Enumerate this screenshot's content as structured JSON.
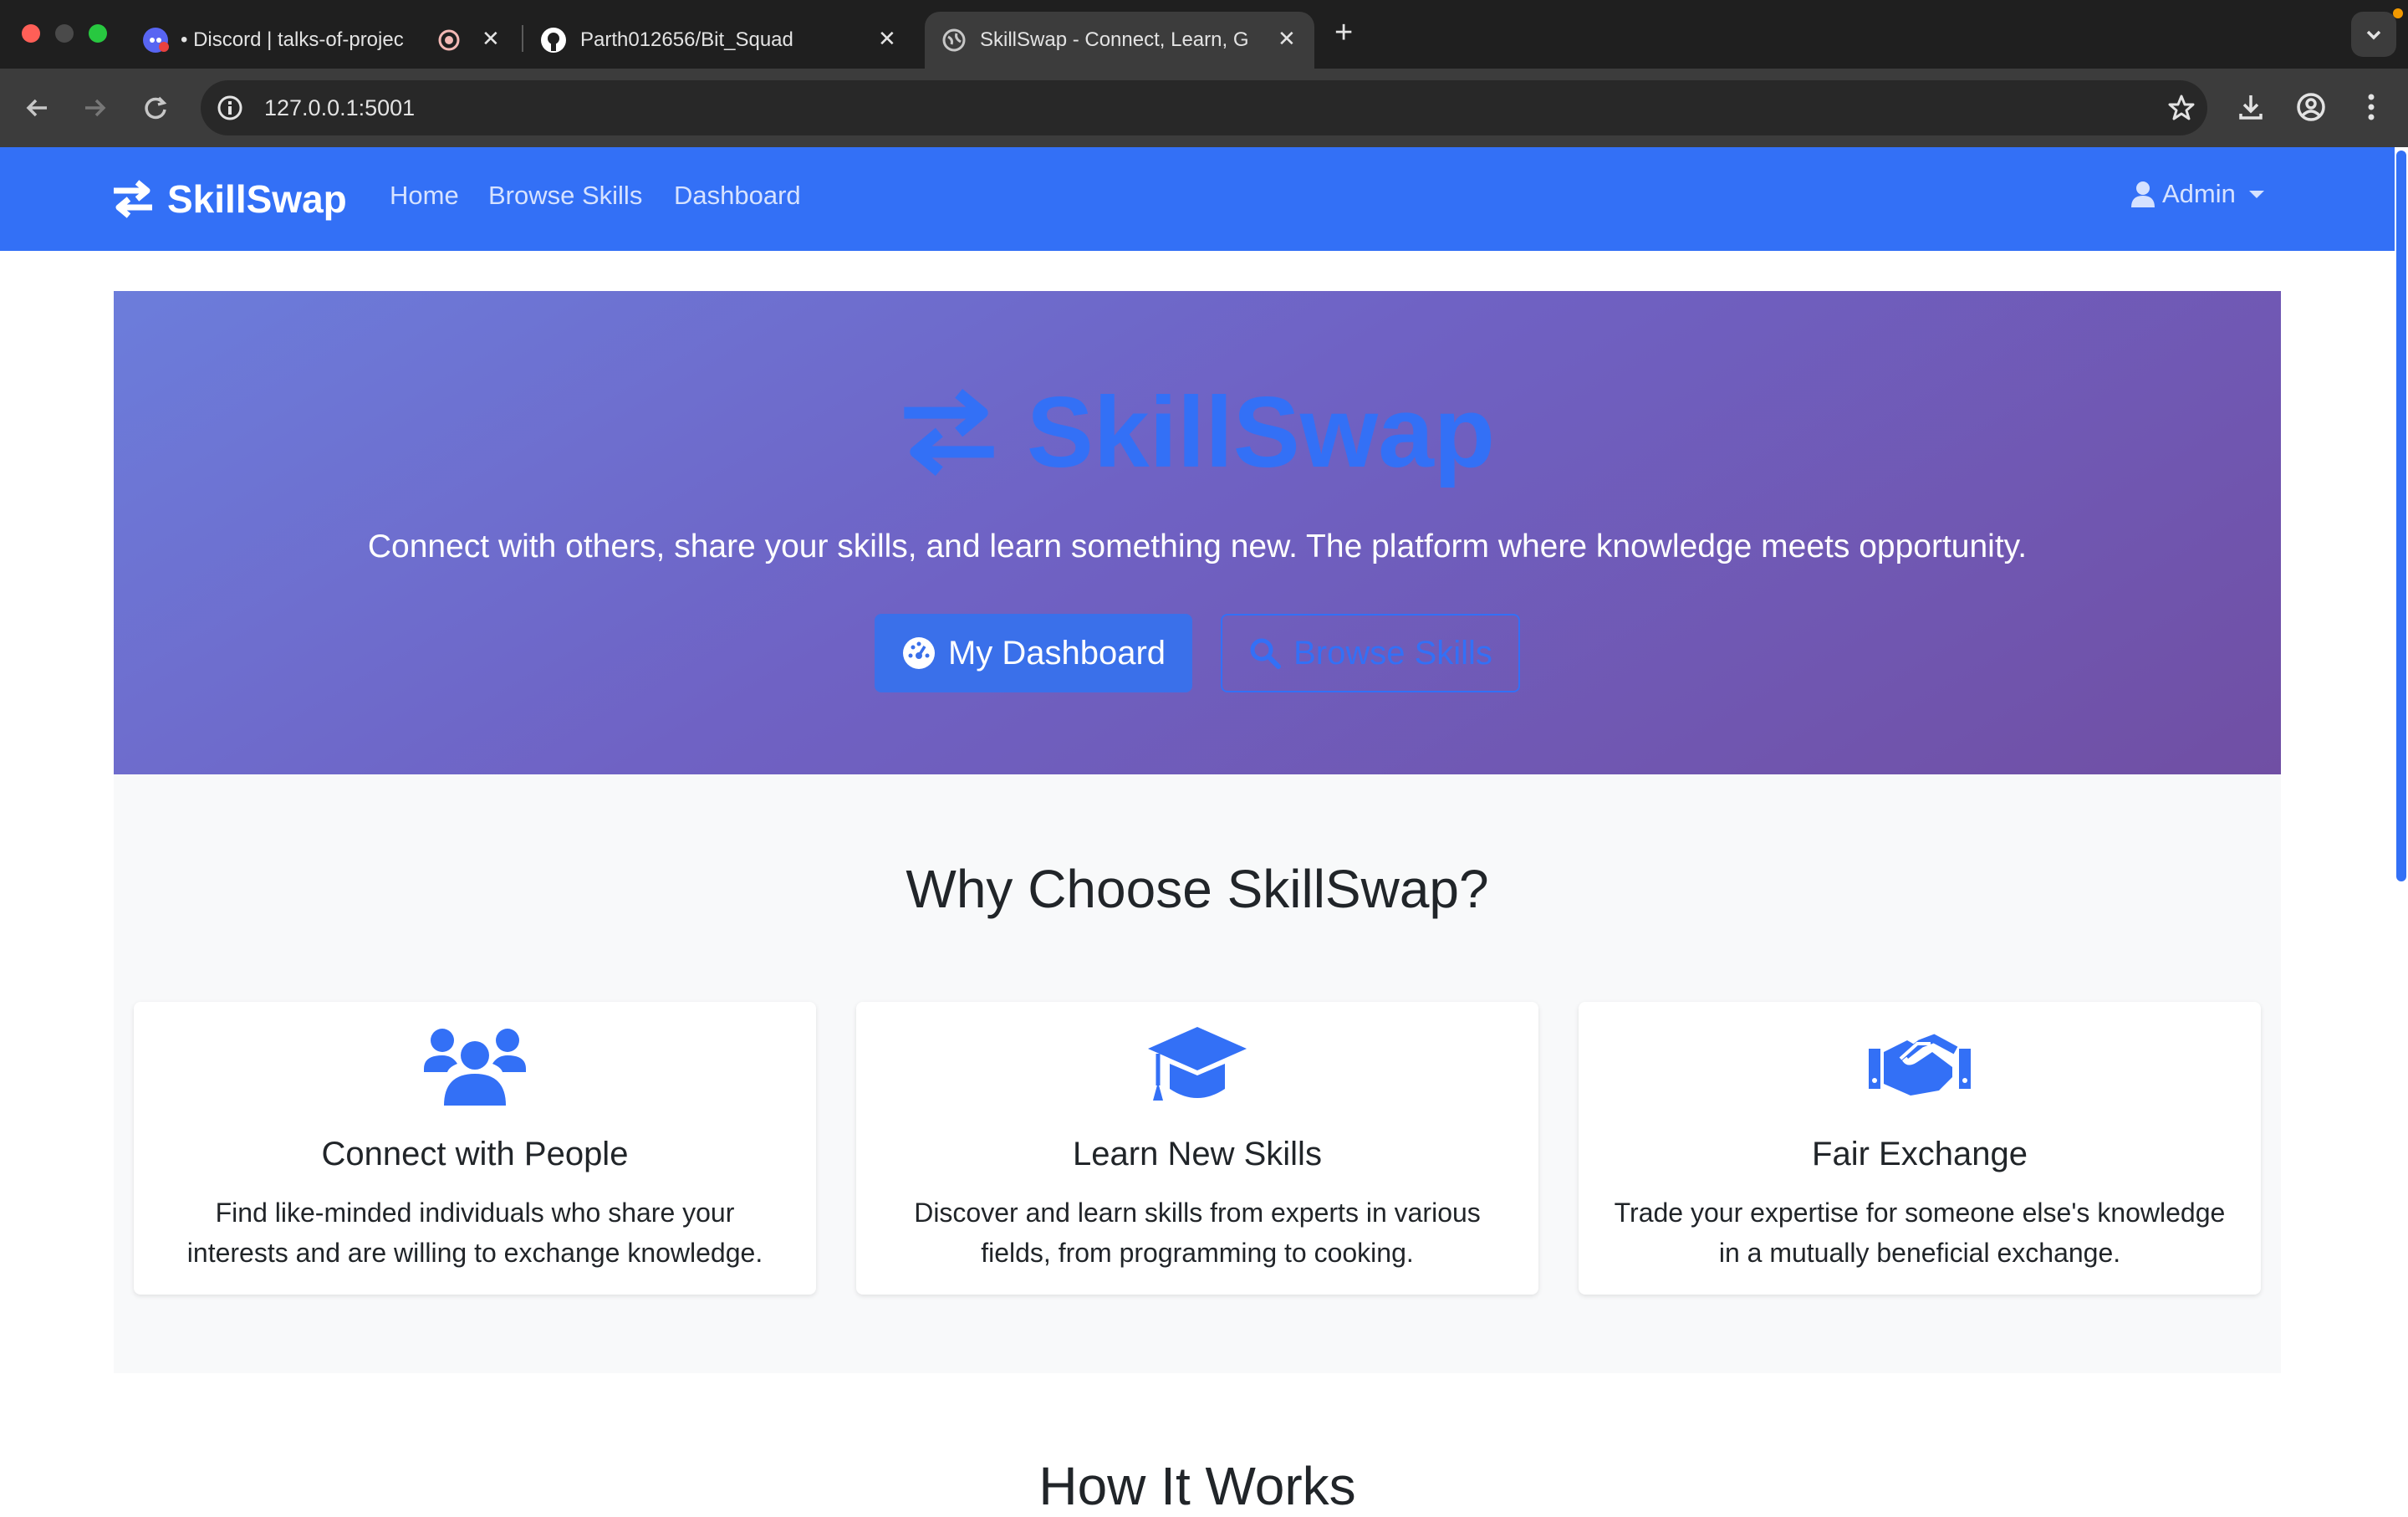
{
  "browser": {
    "tabs": [
      {
        "title": "• Discord | talks-of-projec",
        "favicon": "discord-icon"
      },
      {
        "title": "Parth012656/Bit_Squad",
        "favicon": "github-icon"
      },
      {
        "title": "SkillSwap - Connect, Learn, G",
        "favicon": "globe-icon"
      }
    ],
    "url": "127.0.0.1:5001"
  },
  "navbar": {
    "brand": "SkillSwap",
    "links": [
      "Home",
      "Browse Skills",
      "Dashboard"
    ],
    "user": "Admin"
  },
  "hero": {
    "title": "SkillSwap",
    "subtitle": "Connect with others, share your skills, and learn something new. The platform where knowledge meets opportunity.",
    "primary_button": "My Dashboard",
    "secondary_button": "Browse Skills"
  },
  "features": {
    "title": "Why Choose SkillSwap?",
    "cards": [
      {
        "icon": "users-icon",
        "title": "Connect with People",
        "text": "Find like-minded individuals who share your interests and are willing to exchange knowledge."
      },
      {
        "icon": "graduation-cap-icon",
        "title": "Learn New Skills",
        "text": "Discover and learn skills from experts in various fields, from programming to cooking."
      },
      {
        "icon": "handshake-icon",
        "title": "Fair Exchange",
        "text": "Trade your expertise for someone else's knowledge in a mutually beneficial exchange."
      }
    ]
  },
  "how_it_works": {
    "title": "How It Works"
  },
  "colors": {
    "primary": "#3370f6",
    "hero_gradient_start": "#6c7ddb",
    "hero_gradient_end": "#704fa4",
    "features_bg": "#f8f9fa"
  }
}
